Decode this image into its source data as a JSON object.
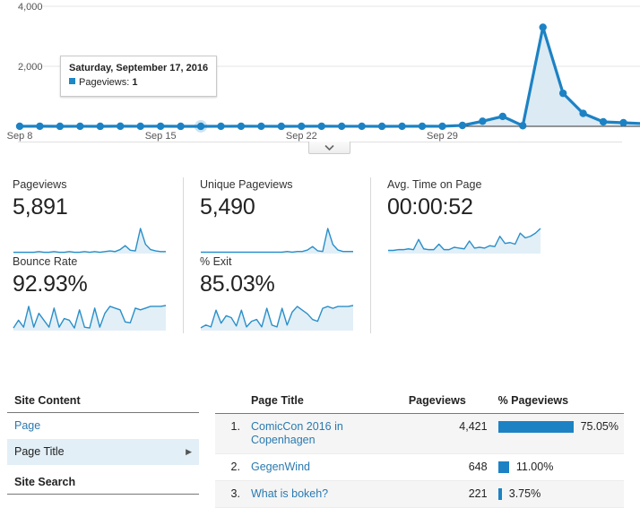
{
  "chart_data": {
    "type": "area",
    "title": "",
    "xlabel": "",
    "ylabel": "",
    "legend": [
      "Pageviews"
    ],
    "grid": true,
    "ylim": [
      0,
      4000
    ],
    "yticks": [
      2000,
      4000
    ],
    "ytick_labels": [
      "2,000",
      "4,000"
    ],
    "xticks": [
      "Sep 8",
      "Sep 15",
      "Sep 22",
      "Sep 29"
    ],
    "xtick_indices": [
      0,
      7,
      14,
      21
    ],
    "series_name": "Pageviews",
    "line_color": "#1c82c4",
    "fill_color": "#dceaf4",
    "x": [
      "Sep 8",
      "Sep 9",
      "Sep 10",
      "Sep 11",
      "Sep 12",
      "Sep 13",
      "Sep 14",
      "Sep 15",
      "Sep 16",
      "Sep 17",
      "Sep 18",
      "Sep 19",
      "Sep 20",
      "Sep 21",
      "Sep 22",
      "Sep 23",
      "Sep 24",
      "Sep 25",
      "Sep 26",
      "Sep 27",
      "Sep 28",
      "Sep 29",
      "Sep 30",
      "Oct 1",
      "Oct 2",
      "Oct 3",
      "Oct 4",
      "Oct 5",
      "Oct 6",
      "Oct 7",
      "Oct 8"
    ],
    "values": [
      2,
      3,
      1,
      2,
      1,
      4,
      2,
      3,
      1,
      1,
      2,
      3,
      2,
      1,
      2,
      3,
      2,
      2,
      1,
      2,
      3,
      2,
      30,
      170,
      330,
      20,
      3300,
      1100,
      430,
      150,
      120
    ],
    "tail_values": [
      90,
      95,
      60
    ],
    "tooltip": {
      "date": "Saturday, September 17, 2016",
      "metric_label": "Pageviews",
      "metric_value": "1",
      "swatch_color": "#1e87c6",
      "point_index": 9
    }
  },
  "chart_controls": {
    "collapse_icon": "chevron-down-icon"
  },
  "metrics": [
    {
      "label": "Pageviews",
      "value": "5,891",
      "spark": [
        2,
        2,
        2,
        2,
        2,
        3,
        2,
        2,
        3,
        2,
        2,
        3,
        2,
        2,
        3,
        2,
        3,
        2,
        3,
        4,
        3,
        6,
        12,
        5,
        4,
        38,
        14,
        6,
        4,
        3,
        3
      ]
    },
    {
      "label": "Unique Pageviews",
      "value": "5,490",
      "spark": [
        2,
        2,
        2,
        2,
        2,
        2,
        2,
        2,
        2,
        2,
        2,
        2,
        2,
        2,
        2,
        2,
        2,
        3,
        2,
        3,
        3,
        5,
        10,
        4,
        3,
        36,
        13,
        5,
        3,
        3,
        3
      ]
    },
    {
      "label": "Avg. Time on Page",
      "value": "00:00:52",
      "spark": [
        4,
        4,
        5,
        5,
        6,
        5,
        18,
        6,
        5,
        5,
        12,
        5,
        5,
        8,
        7,
        6,
        16,
        7,
        8,
        7,
        10,
        9,
        22,
        13,
        14,
        12,
        26,
        20,
        22,
        26,
        32
      ]
    },
    {
      "label": "Bounce Rate",
      "value": "92.93%",
      "spark": [
        3,
        12,
        4,
        28,
        4,
        20,
        12,
        4,
        26,
        4,
        14,
        12,
        3,
        24,
        4,
        3,
        26,
        4,
        20,
        28,
        26,
        24,
        10,
        9,
        26,
        24,
        26,
        28,
        28,
        28,
        29
      ]
    },
    {
      "label": "% Exit",
      "value": "85.03%",
      "spark": [
        3,
        6,
        4,
        22,
        8,
        16,
        14,
        5,
        22,
        4,
        10,
        12,
        4,
        24,
        6,
        4,
        24,
        6,
        20,
        26,
        22,
        18,
        12,
        10,
        24,
        26,
        24,
        26,
        26,
        26,
        27
      ]
    }
  ],
  "sidebar": {
    "sections": [
      {
        "heading": "Site Content",
        "items": [
          {
            "label": "Page",
            "selected": false,
            "caret": ""
          },
          {
            "label": "Page Title",
            "selected": true,
            "caret": "▶"
          }
        ]
      },
      {
        "heading": "Site Search",
        "items": []
      }
    ]
  },
  "table": {
    "columns": [
      "",
      "Page Title",
      "Pageviews",
      "% Pageviews"
    ],
    "rows": [
      {
        "index": "1.",
        "title": "ComicCon 2016 in Copenhagen",
        "pageviews": "4,421",
        "percent": "75.05%",
        "percent_value": 75.05
      },
      {
        "index": "2.",
        "title": "GegenWind",
        "pageviews": "648",
        "percent": "11.00%",
        "percent_value": 11.0
      },
      {
        "index": "3.",
        "title": "What is bokeh?",
        "pageviews": "221",
        "percent": "3.75%",
        "percent_value": 3.75
      }
    ],
    "bar_color": "#1c82c4",
    "bar_max_width": 84
  }
}
